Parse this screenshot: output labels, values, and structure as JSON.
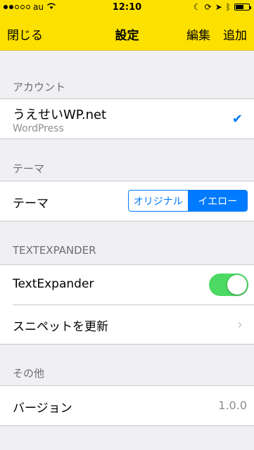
{
  "status_bar": {
    "carrier": "au",
    "time": "12:10",
    "signal_filled": 2,
    "signal_total": 5
  },
  "nav": {
    "left_label": "閉じる",
    "title": "設定",
    "edit_label": "編集",
    "add_label": "追加",
    "bar_color": "#fce000"
  },
  "sections": {
    "account": {
      "header": "アカウント",
      "name": "うえせいWP.net",
      "subtitle": "WordPress",
      "selected": true
    },
    "theme": {
      "header": "テーマ",
      "label": "テーマ",
      "options": [
        "オリジナル",
        "イエロー"
      ],
      "selected_option": "イエロー"
    },
    "textexpander": {
      "header": "TEXTEXPANDER",
      "toggle_label": "TextExpander",
      "toggle_on": true,
      "update_label": "スニペットを更新"
    },
    "other": {
      "header": "その他",
      "version_label": "バージョン",
      "version_value": "1.0.0"
    }
  },
  "colors": {
    "accent": "#007aff",
    "toggle_on": "#4cd964"
  },
  "icons": [
    "wifi-icon",
    "moon-icon",
    "lock-rotation-icon",
    "location-icon",
    "bluetooth-icon",
    "battery-icon",
    "checkmark-icon",
    "chevron-right-icon"
  ]
}
